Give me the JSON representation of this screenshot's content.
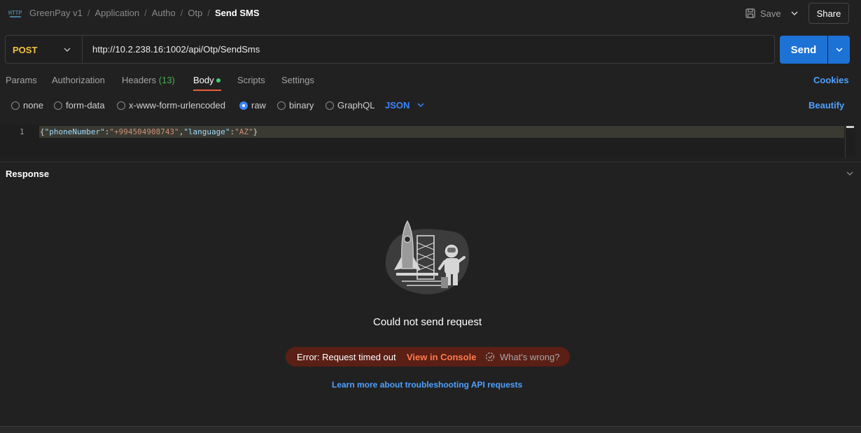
{
  "header": {
    "breadcrumbs": [
      "GreenPay v1",
      "Application",
      "Autho",
      "Otp"
    ],
    "current": "Send SMS",
    "save_label": "Save",
    "share_label": "Share"
  },
  "request": {
    "method": "POST",
    "url": "http://10.2.238.16:1002/api/Otp/SendSms",
    "send_label": "Send"
  },
  "tabs": {
    "params": "Params",
    "authorization": "Authorization",
    "headers": "Headers",
    "headers_count": "(13)",
    "body": "Body",
    "scripts": "Scripts",
    "settings": "Settings",
    "cookies": "Cookies",
    "active": "Body"
  },
  "body_types": {
    "none": "none",
    "form_data": "form-data",
    "urlencoded": "x-www-form-urlencoded",
    "raw": "raw",
    "binary": "binary",
    "graphql": "GraphQL",
    "selected": "raw",
    "format": "JSON",
    "beautify": "Beautify"
  },
  "editor": {
    "line_number": "1",
    "tokens": {
      "open": "{",
      "key1": "\"phoneNumber\"",
      "colon": ":",
      "val1": "\"+994504908743\"",
      "comma": ",",
      "key2": "\"language\"",
      "val2": "\"AZ\"",
      "close": "}"
    }
  },
  "response": {
    "title": "Response",
    "message": "Could not send request",
    "error": "Error: Request timed out",
    "console_link": "View in Console",
    "whats_wrong": "What's wrong?",
    "learn_link": "Learn more about troubleshooting API requests"
  },
  "colors": {
    "background": "#212121",
    "accent_blue": "#1d72d6",
    "method_yellow": "#f0c442",
    "error_bg": "#5a1f15",
    "error_link": "#ff7a4a",
    "active_tab_underline": "#e8603c"
  }
}
